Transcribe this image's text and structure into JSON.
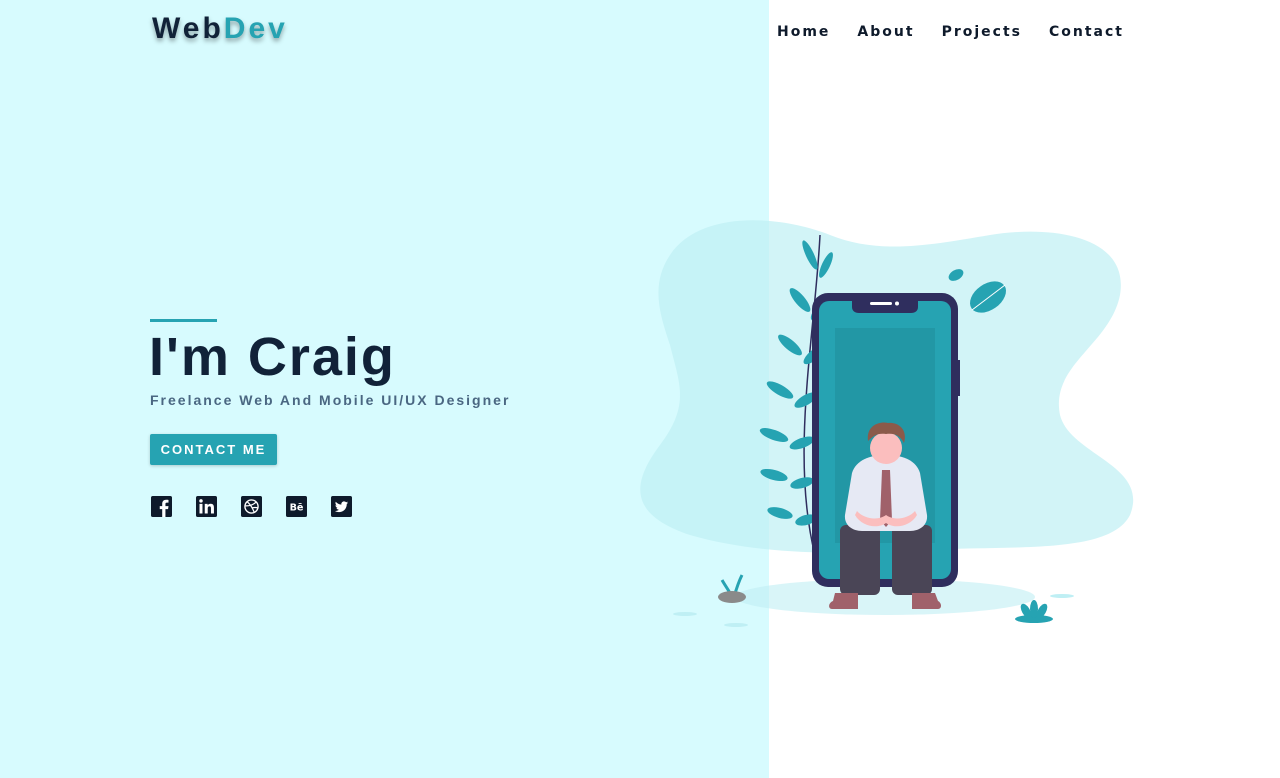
{
  "brand": {
    "logo_part_a": "Web",
    "logo_part_b": "Dev"
  },
  "nav": {
    "items": [
      {
        "label": "Home"
      },
      {
        "label": "About"
      },
      {
        "label": "Projects"
      },
      {
        "label": "Contact"
      }
    ]
  },
  "hero": {
    "title": "I'm Craig",
    "subtitle": "Freelance Web And Mobile UI/UX Designer",
    "cta_label": "CONTACT ME"
  },
  "socials": {
    "icons": [
      "facebook-icon",
      "linkedin-icon",
      "dribbble-icon",
      "behance-icon",
      "twitter-icon"
    ]
  },
  "colors": {
    "left_background": "#d7fbfe",
    "accent": "#26a3b2",
    "dark_text": "#112238",
    "phone_frame": "#2f2e5e"
  }
}
